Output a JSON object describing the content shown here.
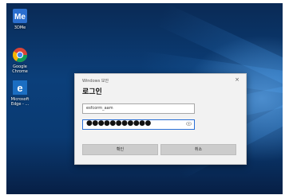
{
  "desktop": {
    "icons": [
      {
        "name": "3DMe",
        "label": "3DMe",
        "icon": "3dme-icon",
        "color": "#2b6fcf"
      },
      {
        "name": "Google Chrome",
        "label": "Google Chrome",
        "icon": "chrome-icon"
      },
      {
        "name": "Microsoft Edge",
        "label": "Microsoft Edge - ...",
        "icon": "edge-icon",
        "color": "#1b6ec2"
      }
    ]
  },
  "dialog": {
    "title": "Windows 보안",
    "close": "×",
    "heading": "로그인",
    "username_value": "esfcorm_aam",
    "password_value": "●●●●●●●●●●●",
    "ok_label": "확인",
    "cancel_label": "취소"
  },
  "colors": {
    "desktop_bg": "#0b3f7a",
    "dialog_bg": "#f2f2f2",
    "focus_border": "#2a6fd6"
  }
}
